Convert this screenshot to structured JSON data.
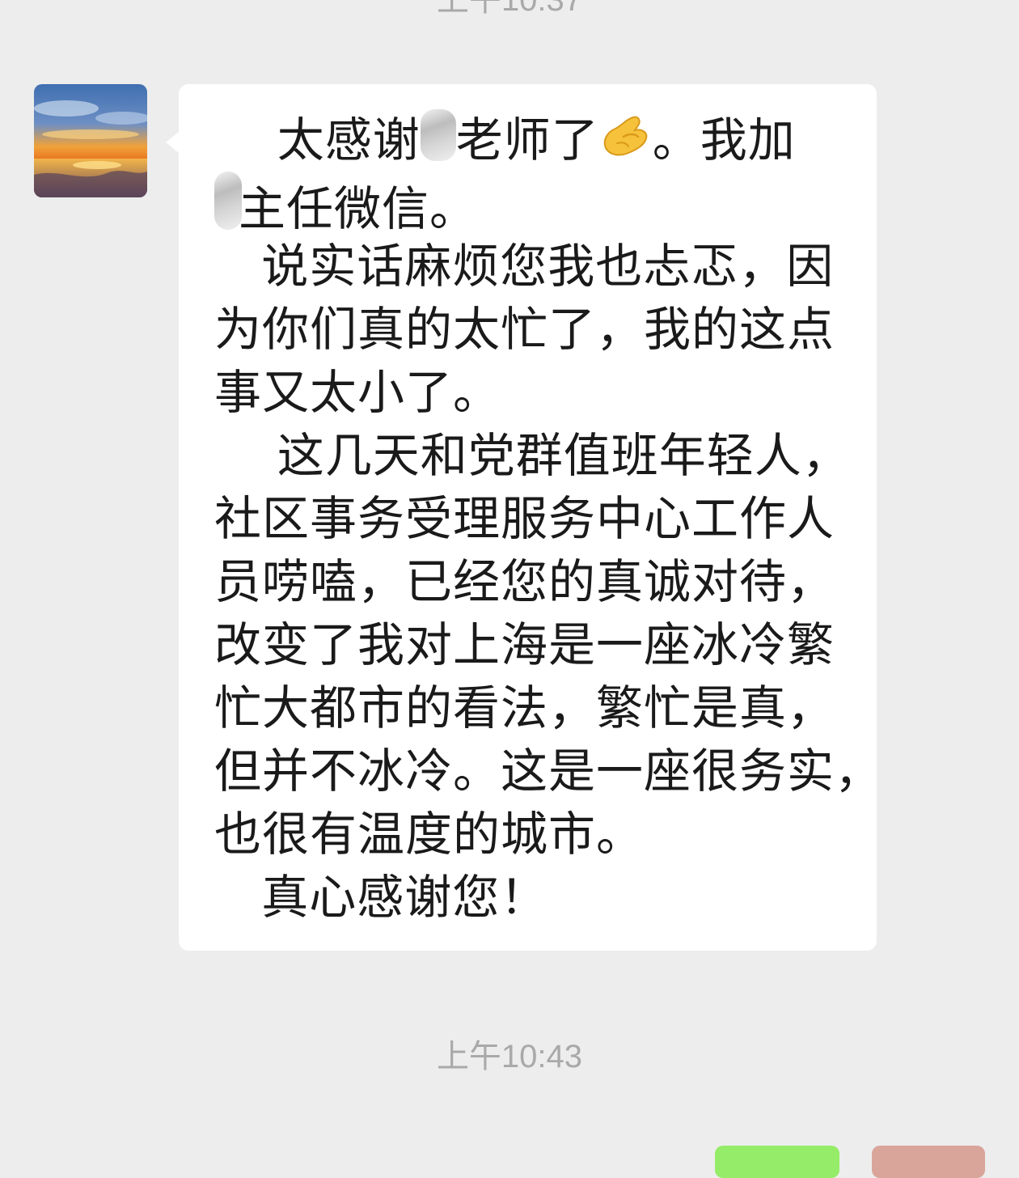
{
  "chat": {
    "timestamp_top": "上午10:37",
    "timestamp_bottom": "上午10:43",
    "message": {
      "line1_a": "    太感谢",
      "line1_b": "老师了",
      "line1_c": "。我加",
      "line2_b": "主任微信。",
      "line3": "   说实话麻烦您我也忐忑，因",
      "line4": "为你们真的太忙了，我的这点",
      "line5": "事又太小了。",
      "line6": "    这几天和党群值班年轻人，",
      "line7": "社区事务受理服务中心工作人",
      "line8": "员唠嗑，已经您的真诚对待，",
      "line9": "改变了我对上海是一座冰冷繁",
      "line10": "忙大都市的看法，繁忙是真，",
      "line11": "但并不冰冷。这是一座很务实，",
      "line12": "也很有温度的城市。",
      "line13": "   真心感谢您！"
    },
    "emoji": "pinching-hand-emoji",
    "colors": {
      "background": "#ededed",
      "bubble": "#ffffff",
      "timestamp": "#a9a9a9",
      "own_bubble": "#95ec69"
    }
  }
}
